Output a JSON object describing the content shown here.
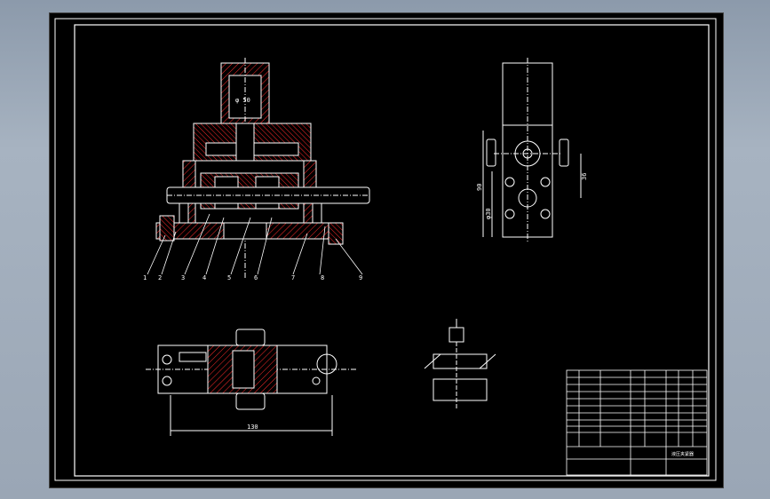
{
  "drawing": {
    "title_block_name": "液压夹紧器",
    "dim_width": "130",
    "dim_height_a": "90",
    "dim_height_b": "36",
    "dim_height_c": "φ30",
    "dim_bore": "φ 50"
  },
  "part_labels": [
    "1",
    "2",
    "3",
    "4",
    "5",
    "6",
    "7",
    "8",
    "9"
  ],
  "colors": {
    "background": "#000000",
    "line": "#ffffff",
    "hatch": "#ff2020",
    "dim": "#ffffff"
  }
}
